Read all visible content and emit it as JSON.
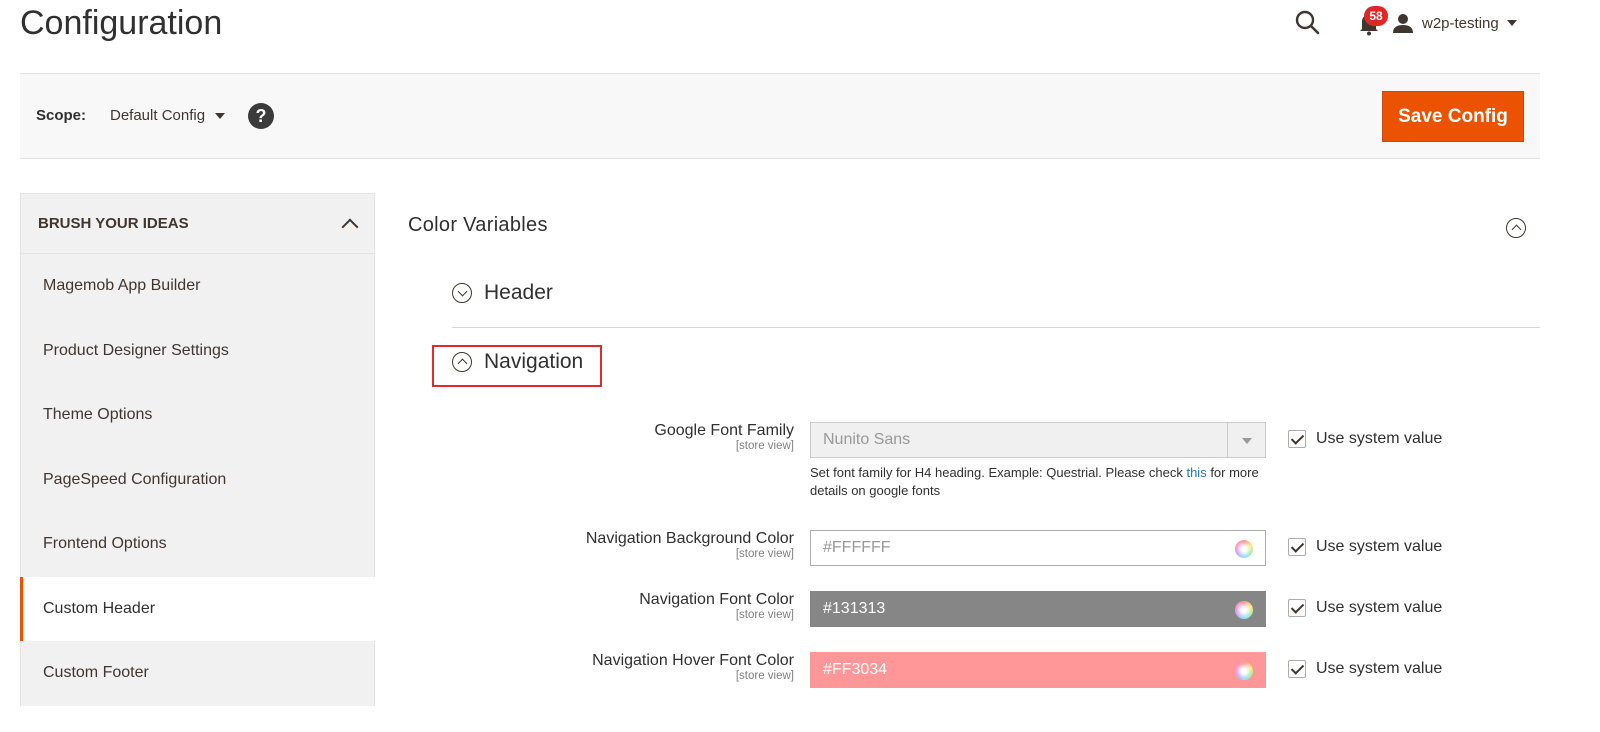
{
  "page": {
    "title": "Configuration"
  },
  "header": {
    "notifications_count": "58",
    "user_name": "w2p-testing"
  },
  "scope": {
    "label": "Scope:",
    "value": "Default Config",
    "save_label": "Save Config"
  },
  "sidebar": {
    "title": "BRUSH YOUR IDEAS",
    "items": [
      {
        "label": "Magemob App Builder"
      },
      {
        "label": "Product Designer Settings"
      },
      {
        "label": "Theme Options"
      },
      {
        "label": "PageSpeed Configuration"
      },
      {
        "label": "Frontend Options"
      },
      {
        "label": "Custom Header"
      },
      {
        "label": "Custom Footer"
      }
    ],
    "active_item": "Custom Header"
  },
  "main": {
    "section_title": "Color Variables",
    "groups": [
      {
        "label": "Header",
        "expanded": false
      },
      {
        "label": "Navigation",
        "expanded": true
      }
    ],
    "fields": [
      {
        "label": "Google Font Family",
        "scope": "[store view]",
        "value": "Nunito Sans",
        "note_before": "Set font family for H4 heading. Example: Questrial. Please check ",
        "note_link": "this",
        "note_after": " for more details on google fonts",
        "use_system_label": "Use system value"
      },
      {
        "label": "Navigation Background Color",
        "scope": "[store view]",
        "value": "#FFFFFF",
        "bg": "#ffffff",
        "text_color": "#999999",
        "use_system_label": "Use system value"
      },
      {
        "label": "Navigation Font Color",
        "scope": "[store view]",
        "value": "#131313",
        "bg": "#868686",
        "text_color": "#ffffff",
        "use_system_label": "Use system value"
      },
      {
        "label": "Navigation Hover Font Color",
        "scope": "[store view]",
        "value": "#FF3034",
        "bg": "#ff9799",
        "text_color": "#ffffff",
        "use_system_label": "Use system value"
      }
    ]
  },
  "colors": {
    "accent": "#eb5202",
    "badge": "#e22626",
    "highlight": "#e02b27",
    "link": "#1979c3"
  }
}
